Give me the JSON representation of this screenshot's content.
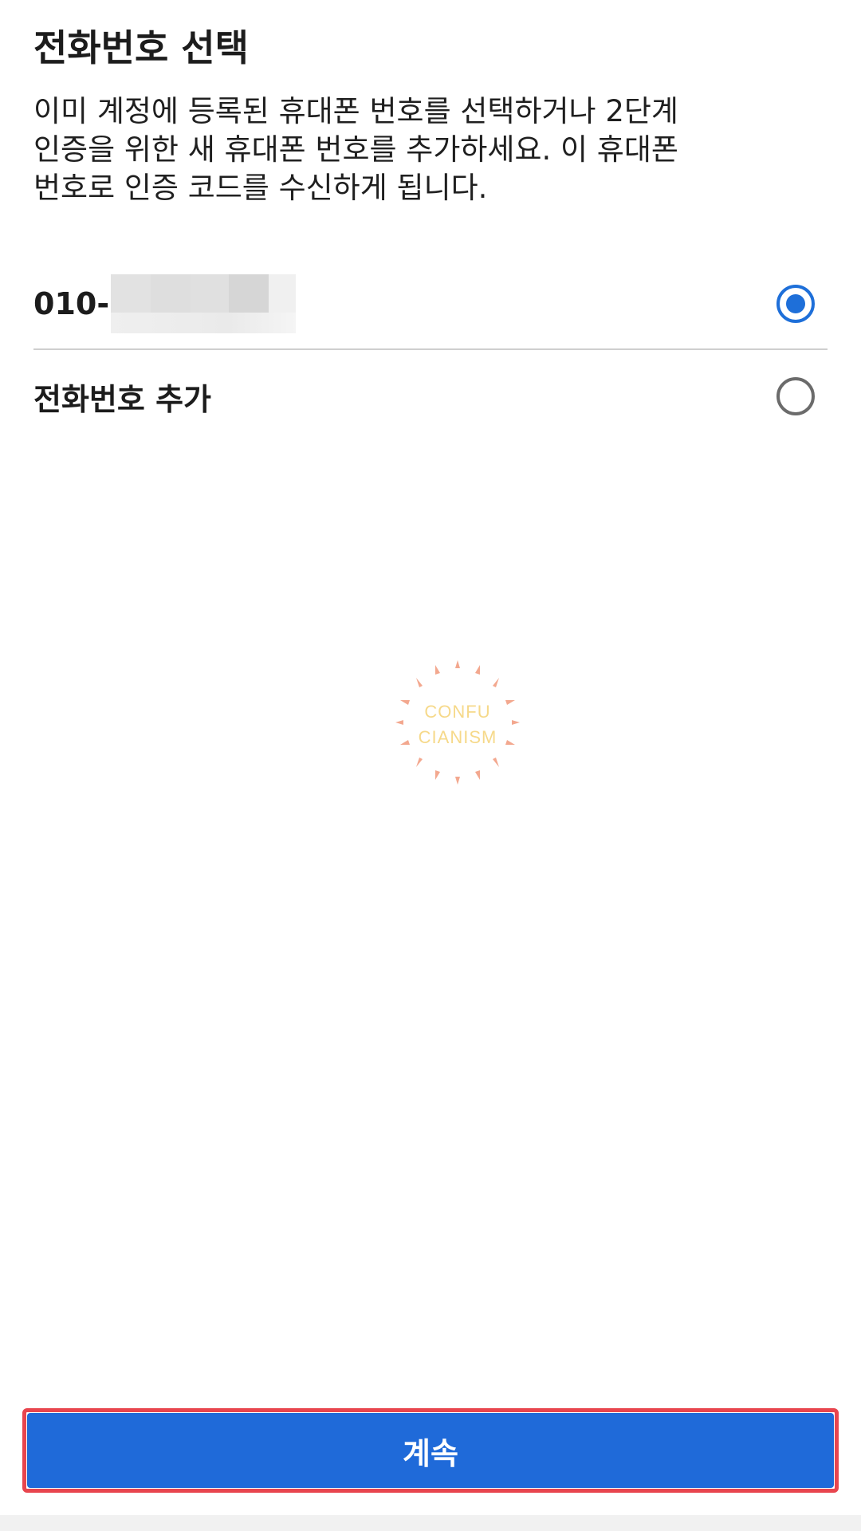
{
  "header": {
    "title": "전화번호 선택"
  },
  "description": {
    "lines": [
      "이미 계정에 등록된 휴대폰 번호를 선택하거나 2단계",
      "인증을 위한 새 휴대폰 번호를 추가하세요. 이 휴대폰",
      "번호로 인증 코드를 수신하게 됩니다."
    ]
  },
  "options": [
    {
      "label": "010-",
      "selected": true,
      "masked": true
    },
    {
      "label": "전화번호 추가",
      "selected": false
    }
  ],
  "watermark": {
    "line1": "CONFU",
    "line2": "CIANISM"
  },
  "footer": {
    "continue_label": "계속"
  },
  "colors": {
    "accent": "#1f6ad9",
    "highlight_outline": "#e8454e",
    "radio_unchecked": "#6b6b6b"
  }
}
